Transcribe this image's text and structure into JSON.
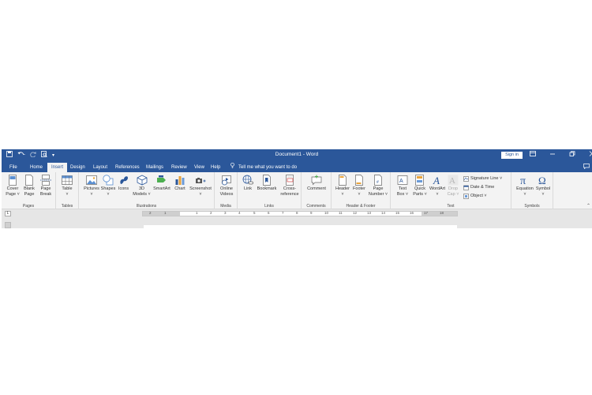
{
  "titlebar": {
    "title": "Document1  -  Word",
    "signin": "Sign in",
    "icons": [
      "save-icon",
      "undo-icon",
      "redo-icon",
      "print-preview-icon",
      "customize-qat-icon"
    ]
  },
  "tabs": [
    "File",
    "Home",
    "Insert",
    "Design",
    "Layout",
    "References",
    "Mailings",
    "Review",
    "View",
    "Help"
  ],
  "tell_me": "Tell me what you want to do",
  "groups": {
    "pages": "Pages",
    "tables": "Tables",
    "illustrations": "Illustrations",
    "media": "Media",
    "links": "Links",
    "comments": "Comments",
    "header_footer": "Header & Footer",
    "text": "Text",
    "symbols": "Symbols"
  },
  "buttons": {
    "cover_page": [
      "Cover",
      "Page ˅"
    ],
    "blank_page": [
      "Blank",
      "Page"
    ],
    "page_break": [
      "Page",
      "Break"
    ],
    "table": [
      "Table",
      "˅"
    ],
    "pictures": [
      "Pictures",
      "˅"
    ],
    "shapes": [
      "Shapes",
      "˅"
    ],
    "icons": [
      "Icons",
      ""
    ],
    "models3d": [
      "3D",
      "Models ˅"
    ],
    "smartart": [
      "SmartArt",
      ""
    ],
    "chart": [
      "Chart",
      ""
    ],
    "screenshot": [
      "Screenshot",
      "˅"
    ],
    "online_videos": [
      "Online",
      "Videos"
    ],
    "link": [
      "Link",
      ""
    ],
    "bookmark": [
      "Bookmark",
      ""
    ],
    "cross_reference": [
      "Cross-",
      "reference"
    ],
    "comment": [
      "Comment",
      ""
    ],
    "header": [
      "Header",
      "˅"
    ],
    "footer": [
      "Footer",
      "˅"
    ],
    "page_number": [
      "Page",
      "Number ˅"
    ],
    "text_box": [
      "Text",
      "Box ˅"
    ],
    "quick_parts": [
      "Quick",
      "Parts ˅"
    ],
    "wordart": [
      "WordArt",
      "˅"
    ],
    "drop_cap": [
      "Drop",
      "Cap ˅"
    ],
    "signature_line": "Signature Line  ˅",
    "date_time": "Date & Time",
    "object": "Object  ˅",
    "equation": [
      "Equation",
      "˅"
    ],
    "symbol": [
      "Symbol",
      "˅"
    ]
  },
  "ruler": {
    "numbers": [
      "2",
      "1",
      "1",
      "2",
      "3",
      "4",
      "5",
      "6",
      "7",
      "8",
      "9",
      "10",
      "11",
      "12",
      "13",
      "14",
      "15",
      "16",
      "17",
      "18"
    ],
    "tab_selector": "L"
  },
  "colors": {
    "word_blue": "#2b579a",
    "ribbon_bg": "#f3f3f3"
  }
}
